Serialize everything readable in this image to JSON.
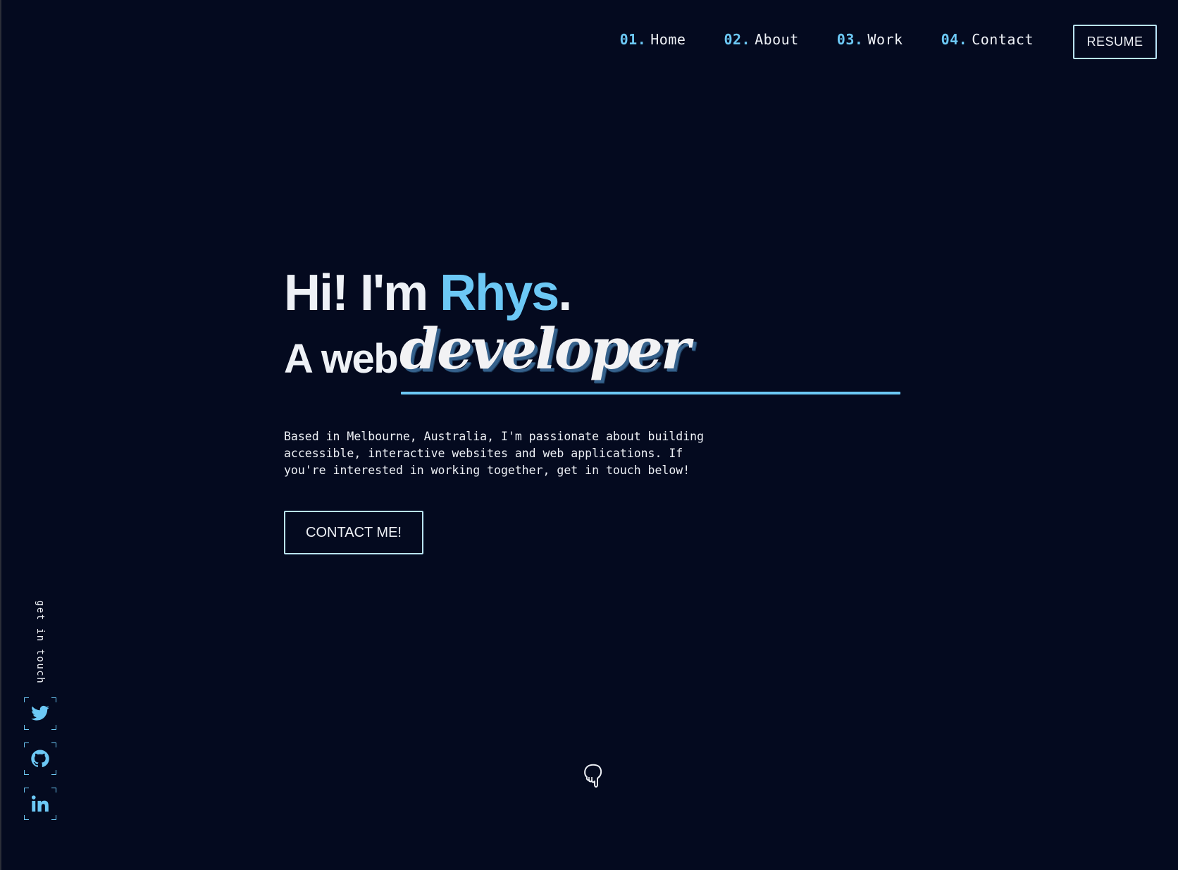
{
  "nav": {
    "links": [
      {
        "num": "01.",
        "label": "Home"
      },
      {
        "num": "02.",
        "label": "About"
      },
      {
        "num": "03.",
        "label": "Work"
      },
      {
        "num": "04.",
        "label": "Contact"
      }
    ],
    "resume_label": "RESUME"
  },
  "hero": {
    "greeting": "Hi! I'm ",
    "name": "Rhys",
    "period": ".",
    "sub_plain": "A web",
    "sub_script": "developer",
    "description": "Based in Melbourne, Australia, I'm passionate about building accessible, interactive websites and web applications. If you're interested in working together, get in touch below!",
    "contact_label": "CONTACT ME!"
  },
  "social": {
    "label": "get in touch",
    "items": [
      "twitter-icon",
      "github-icon",
      "linkedin-icon"
    ]
  },
  "scroll_hint_icon": "pointing-down-hand-icon",
  "colors": {
    "background": "#040a1f",
    "accent": "#6cc8f5",
    "text": "#eef1f6",
    "button_border": "#b9e4fa"
  }
}
